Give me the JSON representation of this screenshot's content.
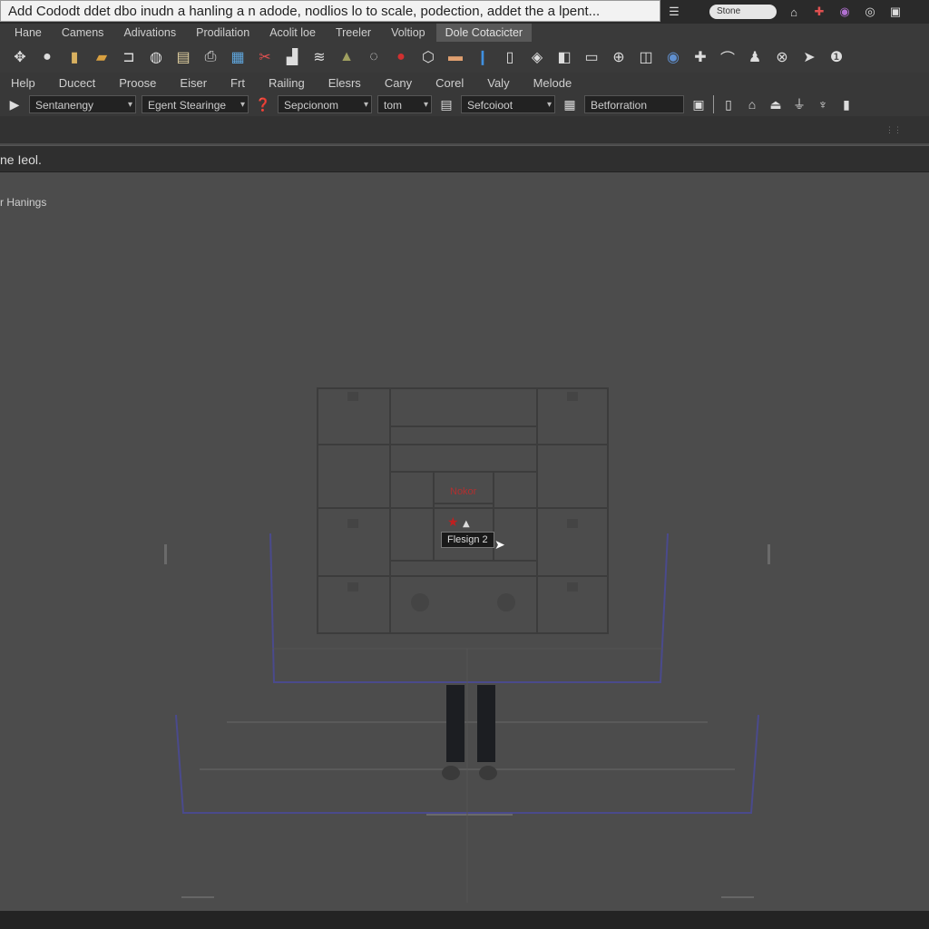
{
  "title_bar": {
    "text": "Add Cododt ddet dbo inudn a hanling a n adode, nodlios lo to scale, podection, addet the a lpent...",
    "search_text": "Stone",
    "icons": [
      "home-icon",
      "pin-icon",
      "star-icon",
      "globe-icon",
      "save-icon"
    ]
  },
  "tabs": [
    {
      "label": "Hane"
    },
    {
      "label": "Camens"
    },
    {
      "label": "Adivations"
    },
    {
      "label": "Prodilation"
    },
    {
      "label": "Acolit loe"
    },
    {
      "label": "Treeler"
    },
    {
      "label": "Voltiop"
    },
    {
      "label": "Dole Cotacicter",
      "active": true
    }
  ],
  "toolbar_icons": [
    "move-icon",
    "circle-icon",
    "box-icon",
    "folder-icon",
    "frame-icon",
    "camera-icon",
    "clipboard-icon",
    "print-icon",
    "file-icon",
    "cut-icon",
    "sofa-icon",
    "paint-icon",
    "triangle-icon",
    "sphere-icon",
    "red-ball-icon",
    "gear-icon",
    "image-icon",
    "blue-marker-icon",
    "page-icon",
    "bell-icon",
    "copy-icon",
    "rectangle-icon",
    "mesh-icon",
    "split-icon",
    "target-icon",
    "cross-icon",
    "link-icon",
    "person-icon",
    "globe-icon",
    "arrow-icon",
    "info-icon"
  ],
  "menu": [
    "Help",
    "Ducect",
    "Proose",
    "Eiser",
    "Frt",
    "Railing",
    "Elesrs",
    "Cany",
    "Corel",
    "Valy",
    "Melode"
  ],
  "dropdowns": {
    "d1": "Sentanengy",
    "d2": "Egent Stearinge",
    "d3": "Sepcionom",
    "d4": "tom",
    "d5": "Sefcoioot",
    "d6": "Betforration"
  },
  "panel": {
    "title": "ne Ieol."
  },
  "viewport": {
    "label": "r Hanings",
    "selection_label": "Nokor",
    "tooltip": "Flesign 2"
  },
  "colors": {
    "accent_red": "#b03030",
    "guide_blue": "#4a4a8c"
  }
}
